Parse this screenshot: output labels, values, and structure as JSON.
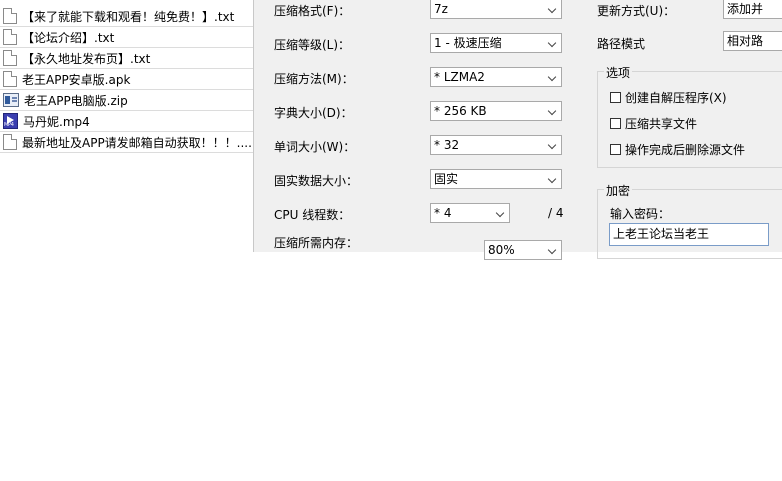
{
  "files": [
    {
      "name": "【来了就能下载和观看！纯免费！】.txt",
      "icon": "text-file-icon"
    },
    {
      "name": "【论坛介绍】.txt",
      "icon": "text-file-icon"
    },
    {
      "name": "【永久地址发布页】.txt",
      "icon": "text-file-icon"
    },
    {
      "name": "老王APP安卓版.apk",
      "icon": "apk-file-icon"
    },
    {
      "name": "老王APP电脑版.zip",
      "icon": "zip-archive-icon"
    },
    {
      "name": "马丹妮.mp4",
      "icon": "video-file-icon"
    },
    {
      "name": "最新地址及APP请发邮箱自动获取！！！....",
      "icon": "text-file-icon"
    }
  ],
  "settings": {
    "format_label": "压缩格式(F)：",
    "format_value": "7z",
    "level_label": "压缩等级(L)：",
    "level_value": "1 - 极速压缩",
    "method_label": "压缩方法(M)：",
    "method_value": "* LZMA2",
    "dict_label": "字典大小(D)：",
    "dict_value": "* 256 KB",
    "word_label": "单词大小(W)：",
    "word_value": "* 32",
    "solid_label": "固实数据大小：",
    "solid_value": "固实",
    "cpu_label": "CPU 线程数：",
    "cpu_value": "* 4",
    "cpu_total": "/ 4",
    "memory_label": "压缩所需内存：",
    "memory_value": "80%"
  },
  "right": {
    "update_label": "更新方式(U)：",
    "update_value": "添加并",
    "path_label": "路径模式",
    "path_value": "相对路"
  },
  "options": {
    "title": "选项",
    "sfx": "创建自解压程序(X)",
    "shared": "压缩共享文件",
    "delete": "操作完成后删除源文件"
  },
  "encryption": {
    "title": "加密",
    "password_label": "输入密码：",
    "password_value": "上老王论坛当老王"
  }
}
